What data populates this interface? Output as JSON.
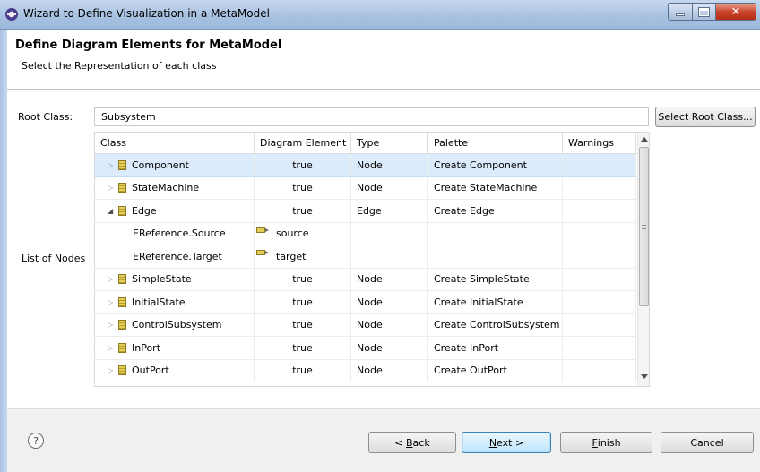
{
  "window": {
    "title": "Wizard to Define Visualization in a MetaModel"
  },
  "header": {
    "title": "Define Diagram Elements for MetaModel",
    "subtitle": "Select the Representation of each class"
  },
  "root_class": {
    "label": "Root Class:",
    "value": "Subsystem",
    "button_label": "Select Root Class..."
  },
  "nodes": {
    "label": "List of Nodes",
    "columns": [
      "Class",
      "Diagram Element",
      "Type",
      "Palette",
      "Warnings"
    ],
    "rows": [
      {
        "name": "Component",
        "diagram": "true",
        "type": "Node",
        "palette": "Create Component",
        "warnings": "",
        "expanded": false,
        "selected": true
      },
      {
        "name": "StateMachine",
        "diagram": "true",
        "type": "Node",
        "palette": "Create StateMachine",
        "warnings": "",
        "expanded": false
      },
      {
        "name": "Edge",
        "diagram": "true",
        "type": "Edge",
        "palette": "Create Edge",
        "warnings": "",
        "expanded": true
      },
      {
        "name": "EReference.Source",
        "diagram": "source",
        "type": "",
        "palette": "",
        "warnings": "",
        "child": true
      },
      {
        "name": "EReference.Target",
        "diagram": "target",
        "type": "",
        "palette": "",
        "warnings": "",
        "child": true
      },
      {
        "name": "SimpleState",
        "diagram": "true",
        "type": "Node",
        "palette": "Create SimpleState",
        "warnings": "",
        "expanded": false
      },
      {
        "name": "InitialState",
        "diagram": "true",
        "type": "Node",
        "palette": "Create InitialState",
        "warnings": "",
        "expanded": false
      },
      {
        "name": "ControlSubsystem",
        "diagram": "true",
        "type": "Node",
        "palette": "Create ControlSubsystem",
        "warnings": "",
        "expanded": false
      },
      {
        "name": "InPort",
        "diagram": "true",
        "type": "Node",
        "palette": "Create InPort",
        "warnings": "",
        "expanded": false
      },
      {
        "name": "OutPort",
        "diagram": "true",
        "type": "Node",
        "palette": "Create OutPort",
        "warnings": "",
        "expanded": false
      }
    ]
  },
  "footer": {
    "help_glyph": "?",
    "back": {
      "pre": "< ",
      "mnemonic": "B",
      "post": "ack"
    },
    "next": {
      "mnemonic": "N",
      "post": "ext >"
    },
    "finish": {
      "mnemonic": "F",
      "post": "inish"
    },
    "cancel": "Cancel"
  },
  "colors": {
    "selected_row": "#dcebfc",
    "class_icon": "#e5cf59",
    "close_button": "#c8442a"
  },
  "icons": {
    "app": "eclipse-icon",
    "class": "class-icon",
    "reference": "reference-icon",
    "help": "help-icon"
  }
}
